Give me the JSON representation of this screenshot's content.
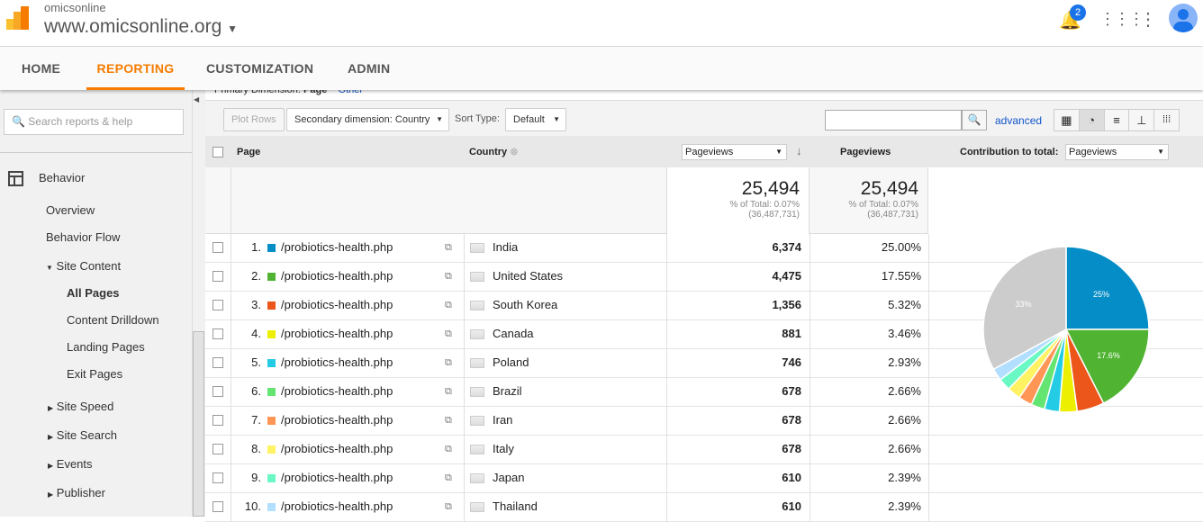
{
  "header": {
    "account": "omicsonline",
    "property": "www.omicsonline.org",
    "notifications": "2"
  },
  "nav": {
    "tabs": [
      "HOME",
      "REPORTING",
      "CUSTOMIZATION",
      "ADMIN"
    ],
    "active": "REPORTING"
  },
  "sidebar": {
    "search_placeholder": "Search reports & help",
    "section": "Behavior",
    "items": [
      "Overview",
      "Behavior Flow"
    ],
    "site_content": "Site Content",
    "sub": [
      "All Pages",
      "Content Drilldown",
      "Landing Pages",
      "Exit Pages"
    ],
    "collapsed": [
      "Site Speed",
      "Site Search",
      "Events",
      "Publisher"
    ]
  },
  "toolbar": {
    "primary_label": "Primary Dimension:",
    "primary_value": "Page",
    "other": "Other",
    "plot_rows": "Plot Rows",
    "secondary": "Secondary dimension: Country",
    "sort_label": "Sort Type:",
    "sort_value": "Default",
    "search_value": "",
    "advanced": "advanced"
  },
  "table": {
    "headers": {
      "page": "Page",
      "country": "Country",
      "metric_select": "Pageviews",
      "metric": "Pageviews",
      "contribution": "Contribution to total:",
      "contribution_select": "Pageviews"
    },
    "totals": {
      "value": "25,494",
      "pct": "% of Total: 0.07%",
      "total": "(36,487,731)"
    },
    "rows": [
      {
        "n": "1.",
        "page": "/probiotics-health.php",
        "country": "India",
        "views": "6,374",
        "pct": "25.00%",
        "color": "#058dc7"
      },
      {
        "n": "2.",
        "page": "/probiotics-health.php",
        "country": "United States",
        "views": "4,475",
        "pct": "17.55%",
        "color": "#50b432"
      },
      {
        "n": "3.",
        "page": "/probiotics-health.php",
        "country": "South Korea",
        "views": "1,356",
        "pct": "5.32%",
        "color": "#ed561b"
      },
      {
        "n": "4.",
        "page": "/probiotics-health.php",
        "country": "Canada",
        "views": "881",
        "pct": "3.46%",
        "color": "#edef00"
      },
      {
        "n": "5.",
        "page": "/probiotics-health.php",
        "country": "Poland",
        "views": "746",
        "pct": "2.93%",
        "color": "#24cbe5"
      },
      {
        "n": "6.",
        "page": "/probiotics-health.php",
        "country": "Brazil",
        "views": "678",
        "pct": "2.66%",
        "color": "#64e572"
      },
      {
        "n": "7.",
        "page": "/probiotics-health.php",
        "country": "Iran",
        "views": "678",
        "pct": "2.66%",
        "color": "#ff9655"
      },
      {
        "n": "8.",
        "page": "/probiotics-health.php",
        "country": "Italy",
        "views": "678",
        "pct": "2.66%",
        "color": "#fff263"
      },
      {
        "n": "9.",
        "page": "/probiotics-health.php",
        "country": "Japan",
        "views": "610",
        "pct": "2.39%",
        "color": "#6af9c4"
      },
      {
        "n": "10.",
        "page": "/probiotics-health.php",
        "country": "Thailand",
        "views": "610",
        "pct": "2.39%",
        "color": "#b2deff"
      }
    ]
  },
  "chart_data": {
    "type": "pie",
    "values": [
      25.0,
      17.55,
      5.32,
      3.46,
      2.93,
      2.66,
      2.66,
      2.66,
      2.39,
      2.39,
      33.0
    ],
    "colors": [
      "#058dc7",
      "#50b432",
      "#ed561b",
      "#edef00",
      "#24cbe5",
      "#64e572",
      "#ff9655",
      "#fff263",
      "#6af9c4",
      "#b2deff",
      "#cccccc"
    ],
    "labels": [
      "25%",
      "17.6%",
      "",
      "",
      "",
      "",
      "",
      "",
      "",
      "",
      "33%"
    ]
  }
}
